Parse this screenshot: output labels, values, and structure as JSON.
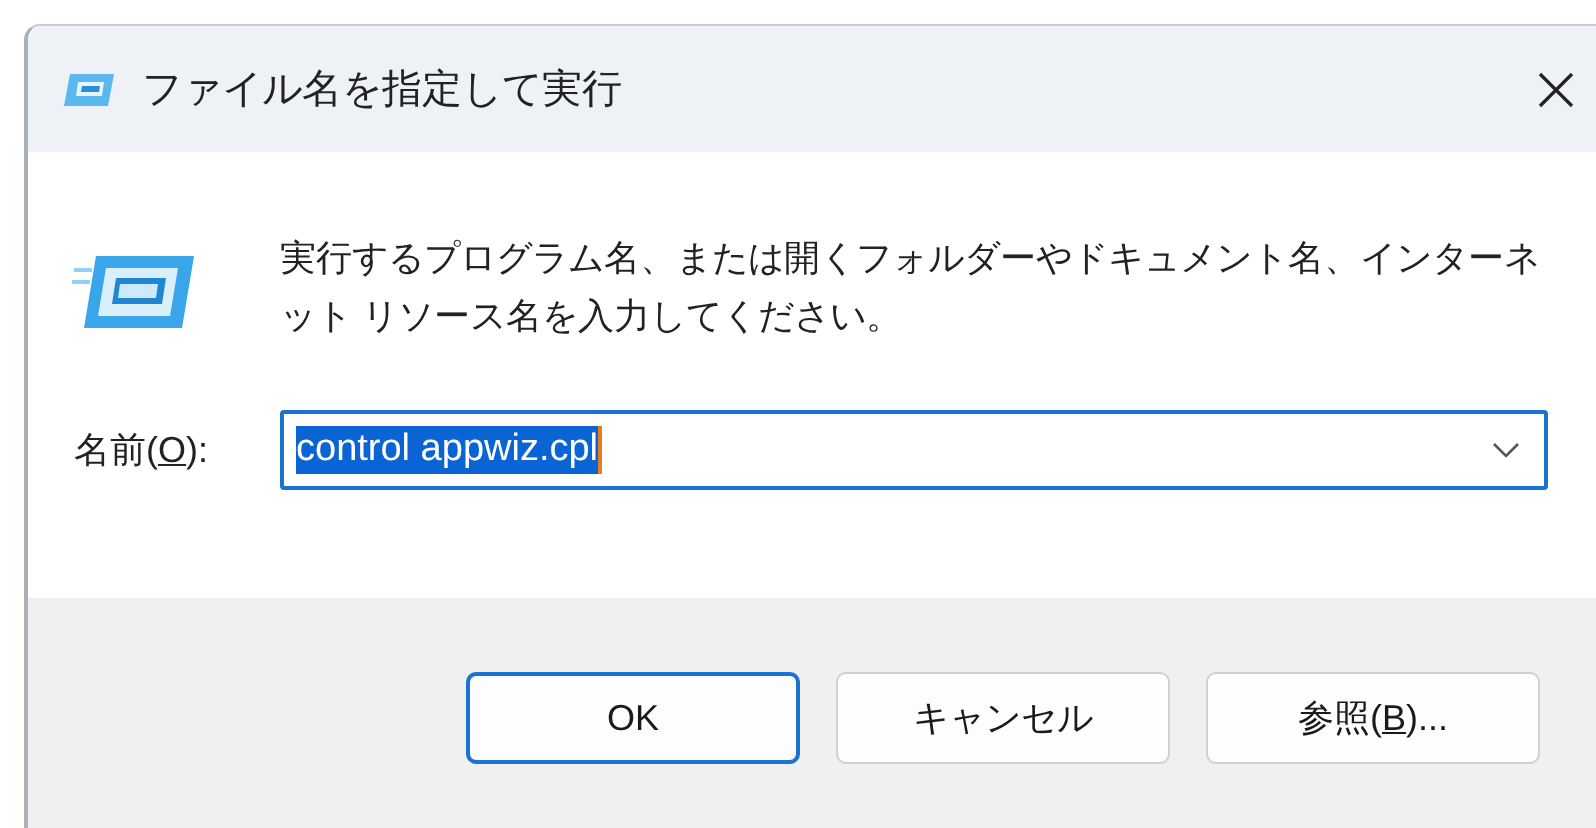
{
  "window": {
    "title": "ファイル名を指定して実行"
  },
  "message": "実行するプログラム名、または開くフォルダーやドキュメント名、インターネット リソース名を入力してください。",
  "name_field": {
    "label_parts": [
      "名前(",
      "O",
      "):"
    ],
    "value": "control appwiz.cpl",
    "selected": true
  },
  "buttons": [
    {
      "label_parts": [
        "OK"
      ],
      "default": true
    },
    {
      "label_parts": [
        "キャンセル"
      ],
      "default": false
    },
    {
      "label_parts": [
        "参照(",
        "B",
        ")..."
      ],
      "default": false
    }
  ]
}
